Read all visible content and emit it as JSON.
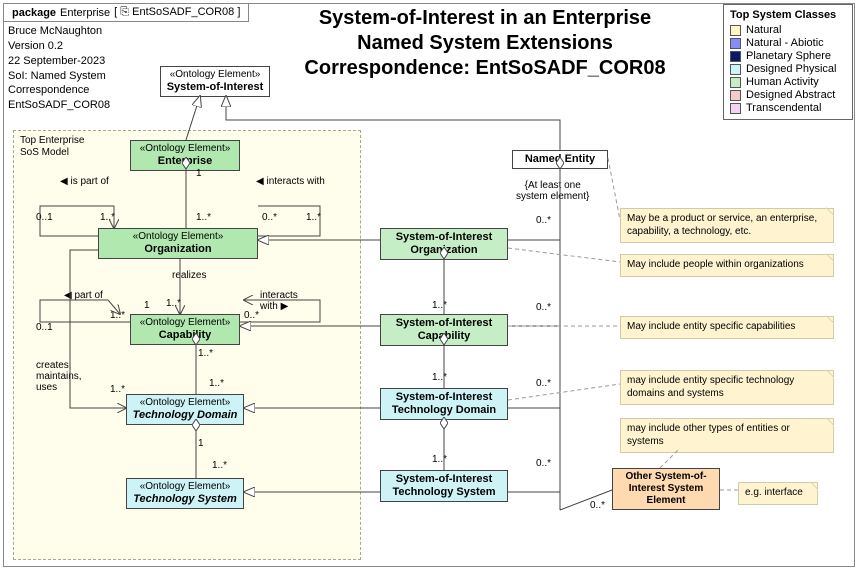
{
  "package": {
    "kw": "package",
    "name": "Enterprise",
    "ref": "EntSoSADF_COR08"
  },
  "header": {
    "line1": "System-of-Interest in an Enterprise",
    "line2": "Named System Extensions",
    "line3": "Correspondence:  EntSoSADF_COR08"
  },
  "meta": {
    "author": "Bruce McNaughton",
    "version": "Version 0.2",
    "date": "22 September-2023",
    "sol_label": "SoI:  Named System",
    "corr_label": "Correspondence",
    "corr_id": "EntSoSADF_COR08"
  },
  "legend": {
    "title": "Top System Classes",
    "items": [
      {
        "label": "Natural",
        "color": "#fdf7c6"
      },
      {
        "label": "Natural - Abiotic",
        "color": "#8a8aff"
      },
      {
        "label": "Planetary Sphere",
        "color": "#0a1a6a"
      },
      {
        "label": "Designed Physical",
        "color": "#cdf3f7"
      },
      {
        "label": "Human Activity",
        "color": "#c6eec6"
      },
      {
        "label": "Designed Abstract",
        "color": "#f7caca"
      },
      {
        "label": "Transcendental",
        "color": "#f4d2f4"
      }
    ]
  },
  "dashbox": {
    "label": "Top Enterprise\nSoS Model"
  },
  "nodes": {
    "soi": {
      "stereo": "«Ontology Element»",
      "name": "System-of-Interest"
    },
    "enterprise": {
      "stereo": "«Ontology Element»",
      "name": "Enterprise"
    },
    "org": {
      "stereo": "«Ontology Element»",
      "name": "Organization"
    },
    "cap": {
      "stereo": "«Ontology Element»",
      "name": "Capability"
    },
    "techdom": {
      "stereo": "«Ontology Element»",
      "name": "Technology Domain"
    },
    "techsys": {
      "stereo": "«Ontology Element»",
      "name": "Technology System"
    },
    "named": {
      "name": "Named Entity"
    },
    "soiorg": {
      "name": "System-of-Interest Organization"
    },
    "soicap": {
      "name": "System-of-Interest Capability"
    },
    "soitd": {
      "name": "System-of-Interest Technology Domain"
    },
    "soits": {
      "name": "System-of-Interest Technology System"
    },
    "other": {
      "name": "Other System-of-Interest System Element"
    }
  },
  "assoc": {
    "is_part_of": "is part of",
    "interacts_with": "interacts with",
    "part_of": "part of",
    "realizes": "realizes",
    "creates": "creates, maintains, uses"
  },
  "mult": {
    "m01": "0..1",
    "m1s": "1..*",
    "m0s": "0..*",
    "m1": "1"
  },
  "constraint": {
    "atleast": "{At least one\nsystem element}"
  },
  "notes": {
    "n1": "May be a product or service, an enterprise, capability, a technology, etc.",
    "n2": "May include people within organizations",
    "n3": "May include entity specific capabilities",
    "n4": "may include entity specific technology domains and systems",
    "n5": "may include other types of entities or systems",
    "n6": "e.g. interface"
  },
  "icons": {
    "pkg": "⎘"
  }
}
